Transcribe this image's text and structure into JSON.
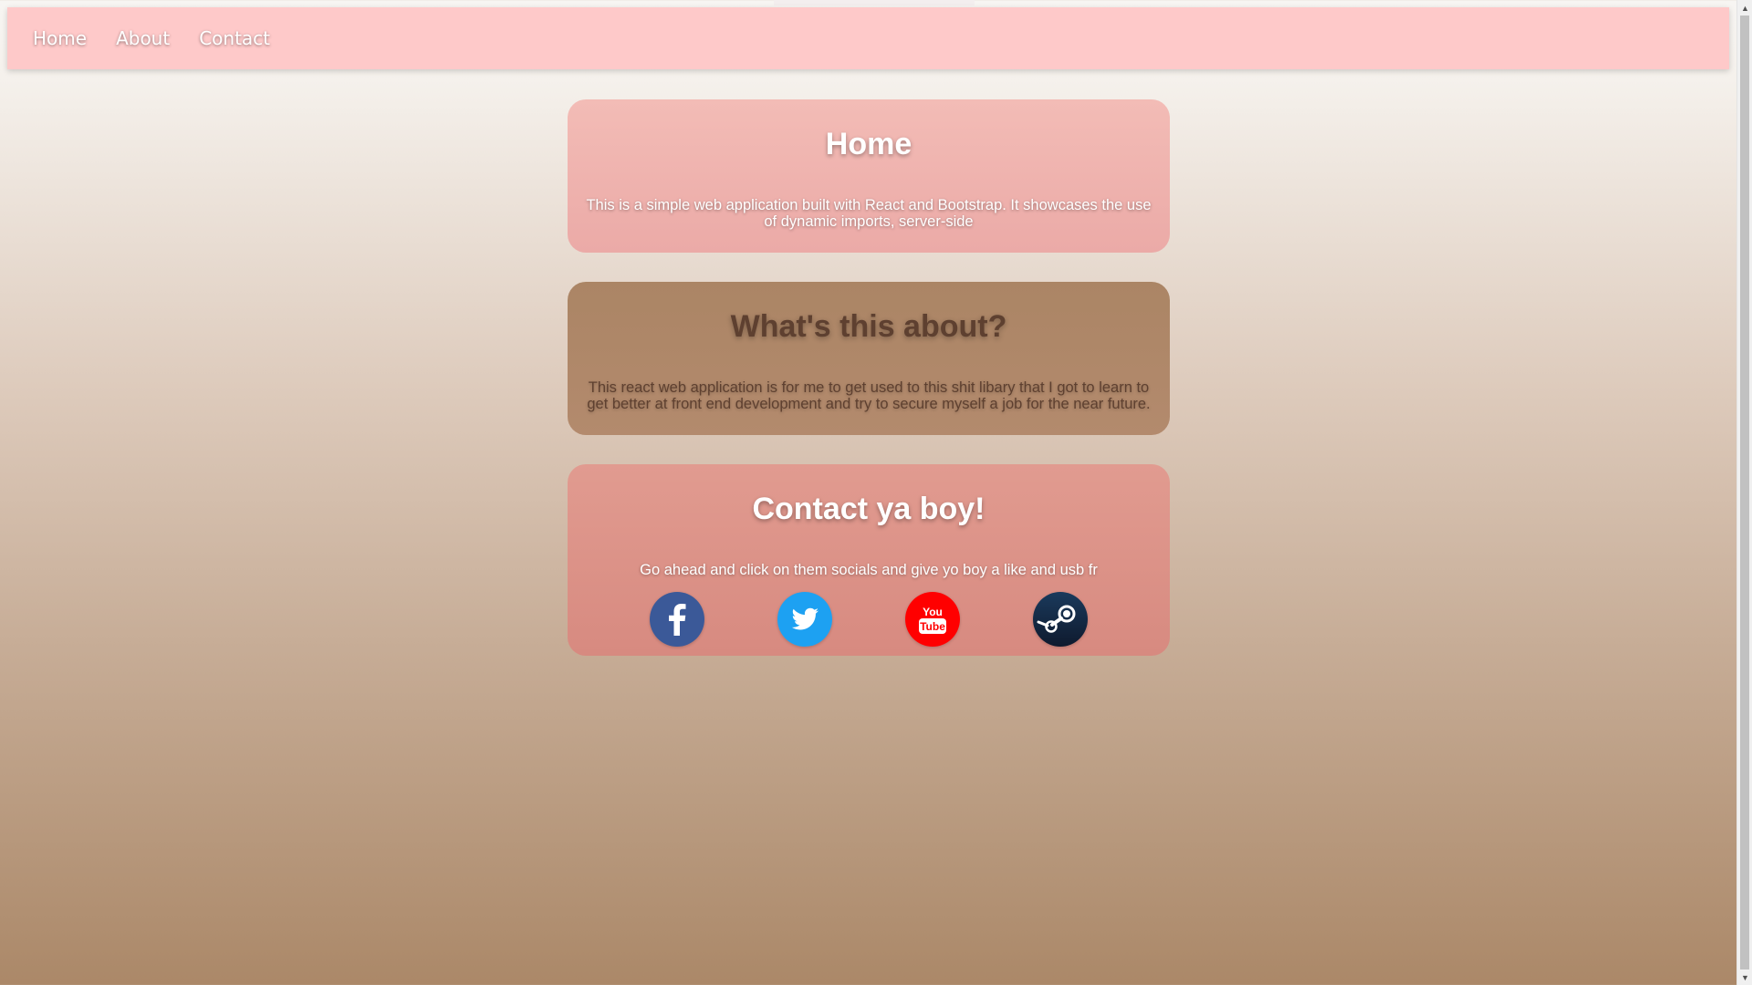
{
  "nav": {
    "links": [
      {
        "label": "Home"
      },
      {
        "label": "About"
      },
      {
        "label": "Contact"
      }
    ]
  },
  "home": {
    "title": "Home",
    "text": "This is a simple web application built with React and Bootstrap. It showcases the use of dynamic imports, server-side"
  },
  "about": {
    "title": "What's this about?",
    "text": "This react web application is for me to get used to this shit libary that I got to learn to get better at front end development and try to secure myself a job for the near future."
  },
  "contact": {
    "title": "Contact ya boy!",
    "text": "Go ahead and click on them socials and give yo boy a like and usb fr",
    "socials": [
      {
        "icon": "facebook-icon",
        "color": "#3b5998"
      },
      {
        "icon": "twitter-icon",
        "color": "#1da1f2"
      },
      {
        "icon": "youtube-icon",
        "color": "#ff0000"
      },
      {
        "icon": "steam-icon",
        "color": "#171a21"
      }
    ]
  },
  "colors": {
    "navbar": "#fec9c9",
    "home_card": "#f3bcb6",
    "about_card": "#ab8565",
    "contact_card": "#e19b90"
  }
}
